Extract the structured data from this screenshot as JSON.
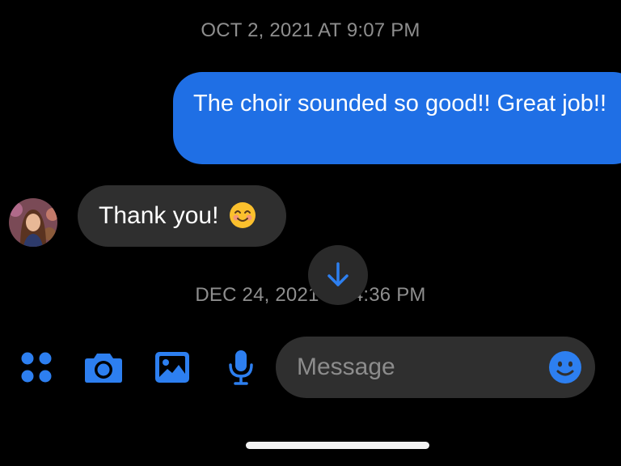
{
  "conversation": {
    "timestamp_1": "OCT 2, 2021 AT 9:07 PM",
    "outgoing_message": "The choir sounded so good!! Great job!!",
    "incoming_message": "Thank you!",
    "timestamp_2": "DEC 24, 2021 AT 4:36 PM"
  },
  "composer": {
    "placeholder": "Message",
    "icons": [
      "apps-icon",
      "camera-icon",
      "gallery-icon",
      "microphone-icon",
      "emoji-icon"
    ]
  },
  "colors": {
    "accent": "#1f6fe5",
    "icon_blue": "#2d7ff0",
    "bubble_gray": "#2f2f2f",
    "timestamp_gray": "#8e8e8e",
    "background": "#000000"
  }
}
